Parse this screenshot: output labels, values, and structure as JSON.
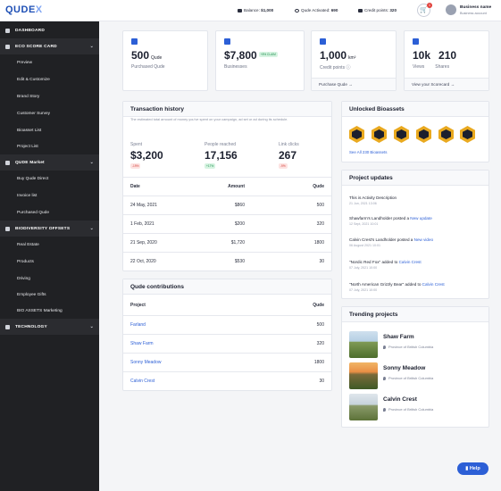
{
  "app": {
    "logo": "QUDE",
    "logo_x": "X"
  },
  "topbar": {
    "balance_label": "Balance:",
    "balance_value": "$1,000",
    "qude_label": "Qude Activated:",
    "qude_value": "690",
    "credit_label": "Credit points:",
    "credit_value": "320",
    "cart_count": "1",
    "business_name": "Business name",
    "business_sub": "Business account"
  },
  "sidebar": {
    "dashboard": "DASHBOARD",
    "eco": "ECO SCORE CARD",
    "eco_items": [
      "Preview",
      "Edit & Customize",
      "Brand Story",
      "Customer Survey",
      "Bioasset List",
      "Project List"
    ],
    "market": "QUDE Market",
    "market_items": [
      "Buy Qude Direct",
      "Invoice list",
      "Purchased Qude"
    ],
    "bio": "BIODIVERSITY OFFSETS",
    "bio_items": [
      "Real Estate",
      "Products",
      "Driving",
      "Employee Gifts",
      "BIO ASSETS Marketing"
    ],
    "tech": "TECHNOLOGY"
  },
  "stats": {
    "qude": {
      "value": "500",
      "unit": "Qude",
      "label": "Purchased Qude"
    },
    "businesses": {
      "value": "$7,800",
      "pill": "+8% CLAIM",
      "label": "Businesses"
    },
    "credit": {
      "value": "1,000",
      "unit": "km²",
      "label": "Credit points",
      "footer": "Purchase Qude"
    },
    "views": {
      "value1": "10k",
      "label1": "Views",
      "value2": "210",
      "label2": "Shares",
      "footer": "View your Scorecard"
    }
  },
  "transactions": {
    "title": "Transaction history",
    "desc": "The estimated total amount of money you've spent on your campaign, ad set or ad during its schedule.",
    "kpis": [
      {
        "label": "Spent",
        "value": "$3,200",
        "pill": "-19%"
      },
      {
        "label": "People reached",
        "value": "17,156",
        "pill": "+17%"
      },
      {
        "label": "Link clicks",
        "value": "267",
        "pill": "-9%"
      }
    ],
    "headers": {
      "date": "Date",
      "amount": "Amount",
      "qude": "Qude"
    },
    "rows": [
      {
        "date": "24 May, 2021",
        "amount": "$860",
        "qude": "500"
      },
      {
        "date": "1 Feb, 2021",
        "amount": "$200",
        "qude": "320"
      },
      {
        "date": "21 Sep, 2020",
        "amount": "$1,720",
        "qude": "1800"
      },
      {
        "date": "22 Oct, 2020",
        "amount": "$530",
        "qude": "30"
      }
    ]
  },
  "contributions": {
    "title": "Qude contributions",
    "headers": {
      "project": "Project",
      "qude": "Qude"
    },
    "rows": [
      {
        "project": "Farland",
        "qude": "500"
      },
      {
        "project": "Shaw Farm",
        "qude": "320"
      },
      {
        "project": "Sonny Meadow",
        "qude": "1800"
      },
      {
        "project": "Calvin Crest",
        "qude": "30"
      }
    ]
  },
  "bioassets": {
    "title": "Unlocked Bioassets",
    "see_all": "See All 230 Bioassets"
  },
  "updates": {
    "title": "Project updates",
    "items": [
      {
        "text": "This is Activity Description",
        "date": "21 Jun, 2021 13:06"
      },
      {
        "text": "Shawfarm's Landholder posted a ",
        "link": "New update",
        "date": "12 Sept, 2021 10:01"
      },
      {
        "text": "Calvin Crest's Landholder posted a ",
        "link": "New video",
        "date": "06 August 2021 10:01"
      },
      {
        "text": "\"Nordic Red Fox\" added to ",
        "link": "Calvin Crest",
        "date": "07 July, 2021 10:00"
      },
      {
        "text": "\"North American Grizzly Bear\" added to ",
        "link": "Calvin Crest",
        "date": "07 July, 2021 10:00"
      }
    ]
  },
  "trending": {
    "title": "Trending projects",
    "items": [
      {
        "name": "Shaw Farm",
        "location": "Province of British Columbia"
      },
      {
        "name": "Sonny Meadow",
        "location": "Province of British Columbia"
      },
      {
        "name": "Calvin Crest",
        "location": "Province of British Columbia"
      }
    ]
  },
  "help": "Help",
  "colors": {
    "accent": "#2c5fd6",
    "sidebar": "#202124",
    "badge": "#e9a91f"
  }
}
